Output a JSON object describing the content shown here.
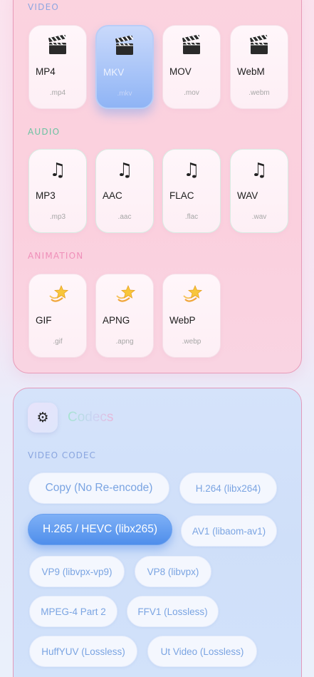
{
  "sections": {
    "video": "VIDEO",
    "audio": "AUDIO",
    "animation": "ANIMATION"
  },
  "video_formats": [
    {
      "name": "MP4",
      "ext": ".mp4",
      "icon": "clapperboard-icon"
    },
    {
      "name": "MKV",
      "ext": ".mkv",
      "icon": "clapperboard-icon",
      "selected": true
    },
    {
      "name": "MOV",
      "ext": ".mov",
      "icon": "clapperboard-icon"
    },
    {
      "name": "WebM",
      "ext": ".webm",
      "icon": "clapperboard-icon"
    }
  ],
  "audio_formats": [
    {
      "name": "MP3",
      "ext": ".mp3",
      "icon": "music-note-icon"
    },
    {
      "name": "AAC",
      "ext": ".aac",
      "icon": "music-note-icon"
    },
    {
      "name": "FLAC",
      "ext": ".flac",
      "icon": "music-note-icon"
    },
    {
      "name": "WAV",
      "ext": ".wav",
      "icon": "music-note-icon"
    }
  ],
  "animation_formats": [
    {
      "name": "GIF",
      "ext": ".gif",
      "icon": "dizzy-star-icon"
    },
    {
      "name": "APNG",
      "ext": ".apng",
      "icon": "dizzy-star-icon"
    },
    {
      "name": "WebP",
      "ext": ".webp",
      "icon": "dizzy-star-icon"
    }
  ],
  "codecs": {
    "title": "Codecs",
    "icon": "gear-icon",
    "video_codec_label": "VIDEO CODEC",
    "options": [
      {
        "label": "Copy (No Re-encode)"
      },
      {
        "label": "H.264 (libx264)"
      },
      {
        "label": "H.265 / HEVC (libx265)",
        "selected": true
      },
      {
        "label": "AV1 (libaom-av1)"
      },
      {
        "label": "VP9 (libvpx-vp9)"
      },
      {
        "label": "VP8 (libvpx)"
      },
      {
        "label": "MPEG-4 Part 2"
      },
      {
        "label": "FFV1 (Lossless)"
      },
      {
        "label": "HuffYUV (Lossless)"
      },
      {
        "label": "Ut Video (Lossless)"
      }
    ]
  },
  "colors": {
    "accent_blue": "#4f8eeb",
    "pink_panel": "#fbd0de",
    "blue_panel": "#d2e2fa"
  }
}
